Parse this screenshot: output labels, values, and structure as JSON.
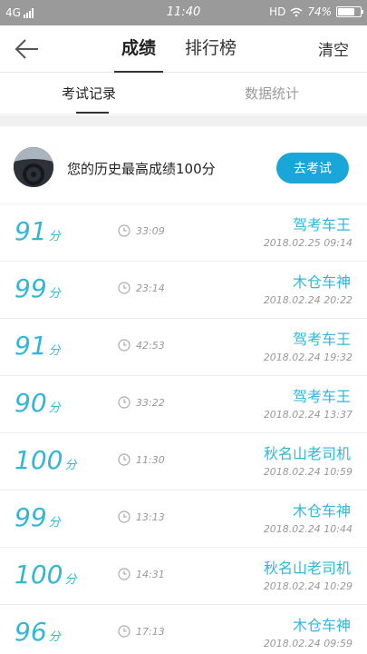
{
  "status_bar": {
    "network": "4G",
    "time": "11:40",
    "hd": "HD",
    "battery_text": "74%",
    "battery_level": 0.74
  },
  "nav": {
    "tab_scores": "成绩",
    "tab_ranking": "排行榜",
    "clear": "清空"
  },
  "subtabs": {
    "exam_records": "考试记录",
    "statistics": "数据统计"
  },
  "best": {
    "text": "您的历史最高成绩100分",
    "button": "去考试"
  },
  "records": [
    {
      "score": "91",
      "unit": "分",
      "duration": "33:09",
      "title": "驾考车王",
      "date": "2018.02.25  09:14"
    },
    {
      "score": "99",
      "unit": "分",
      "duration": "23:14",
      "title": "木仓车神",
      "date": "2018.02.24  20:22"
    },
    {
      "score": "91",
      "unit": "分",
      "duration": "42:53",
      "title": "驾考车王",
      "date": "2018.02.24  19:32"
    },
    {
      "score": "90",
      "unit": "分",
      "duration": "33:22",
      "title": "驾考车王",
      "date": "2018.02.24  13:37"
    },
    {
      "score": "100",
      "unit": "分",
      "duration": "11:30",
      "title": "秋名山老司机",
      "date": "2018.02.24  10:59"
    },
    {
      "score": "99",
      "unit": "分",
      "duration": "13:13",
      "title": "木仓车神",
      "date": "2018.02.24  10:44"
    },
    {
      "score": "100",
      "unit": "分",
      "duration": "14:31",
      "title": "秋名山老司机",
      "date": "2018.02.24  10:29"
    },
    {
      "score": "96",
      "unit": "分",
      "duration": "17:13",
      "title": "木仓车神",
      "date": "2018.02.24  09:59"
    }
  ],
  "colors": {
    "accent": "#2fb7d6",
    "button": "#1aa6d9",
    "status_bar": "#9a9a9a"
  }
}
